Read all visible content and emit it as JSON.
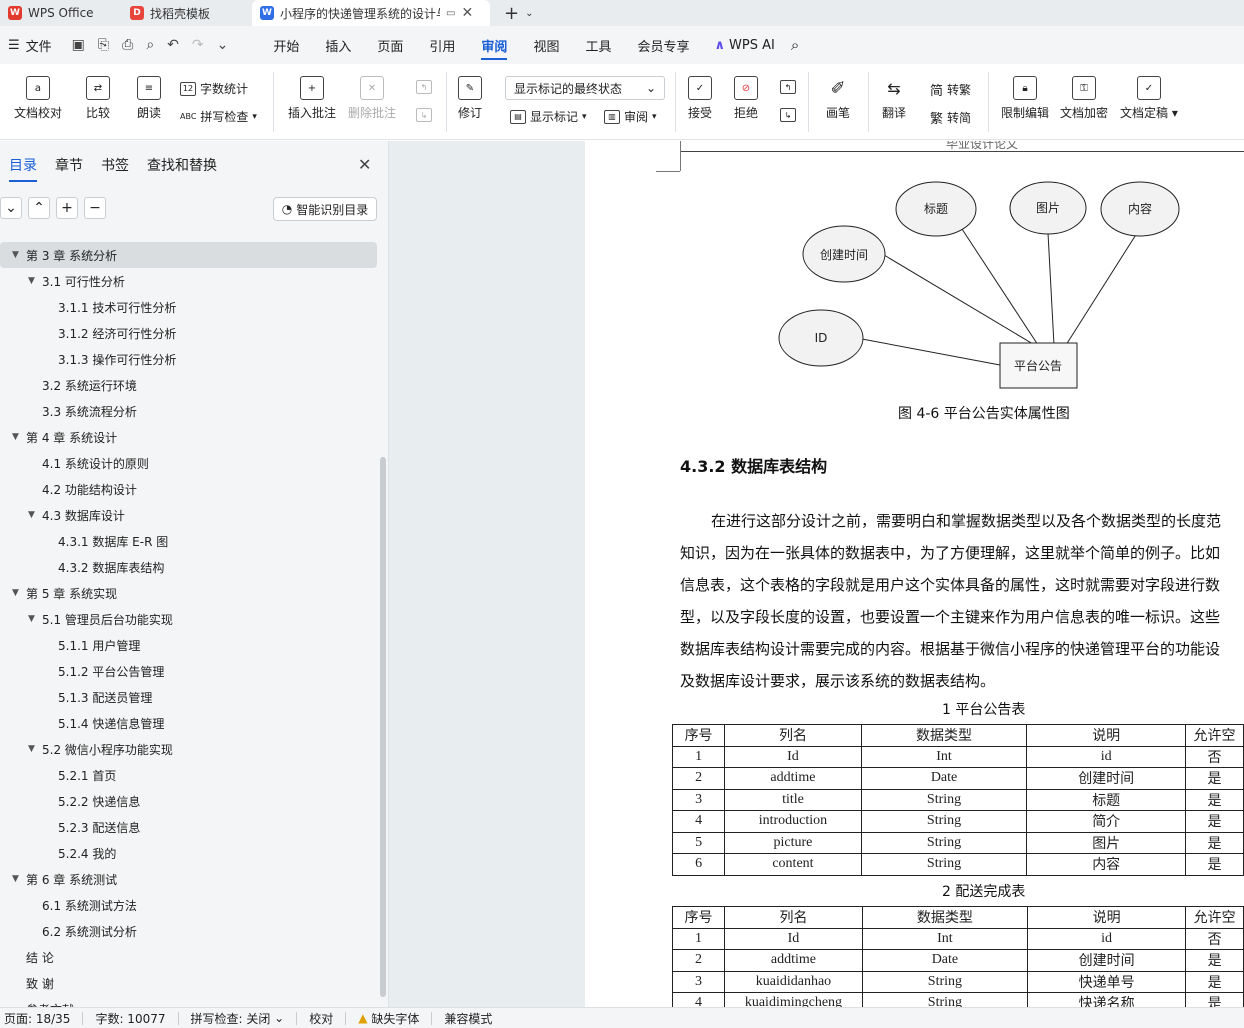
{
  "tabs": [
    {
      "label": "WPS Office"
    },
    {
      "label": "找稻壳模板"
    },
    {
      "label": "小程序的快递管理系统的设计与"
    }
  ],
  "menu": {
    "file": "文件",
    "items": [
      "开始",
      "插入",
      "页面",
      "引用",
      "审阅",
      "视图",
      "工具",
      "会员专享"
    ],
    "active": "审阅",
    "wps_ai": "WPS AI"
  },
  "ribbon": {
    "doc_check": "文档校对",
    "compare": "比较",
    "read_aloud": "朗读",
    "word_count": "字数统计",
    "spell_check": "拼写检查",
    "insert_comment": "插入批注",
    "delete_comment": "删除批注",
    "track": "修订",
    "markup_select": "显示标记的最终状态",
    "show_markup": "显示标记",
    "review": "审阅",
    "accept": "接受",
    "reject": "拒绝",
    "pen": "画笔",
    "translate": "翻译",
    "to_traditional": "转繁",
    "to_simplified": "转简",
    "restrict_edit": "限制编辑",
    "encrypt": "文档加密",
    "finalize": "文档定稿"
  },
  "nav": {
    "tabs": [
      "目录",
      "章节",
      "书签",
      "查找和替换"
    ],
    "smart_toc": "智能识别目录",
    "toc": [
      {
        "label": "第 3 章  系统分析",
        "level": 1,
        "expanded": true,
        "selected": true
      },
      {
        "label": "3.1 可行性分析",
        "level": 2,
        "expanded": true
      },
      {
        "label": "3.1.1 技术可行性分析",
        "level": 3
      },
      {
        "label": "3.1.2 经济可行性分析",
        "level": 3
      },
      {
        "label": "3.1.3 操作可行性分析",
        "level": 3
      },
      {
        "label": "3.2 系统运行环境",
        "level": 2
      },
      {
        "label": "3.3 系统流程分析",
        "level": 2
      },
      {
        "label": "第 4 章  系统设计",
        "level": 1,
        "expanded": true
      },
      {
        "label": "4.1  系统设计的原则",
        "level": 2
      },
      {
        "label": "4.2  功能结构设计",
        "level": 2
      },
      {
        "label": "4.3  数据库设计",
        "level": 2,
        "expanded": true
      },
      {
        "label": "4.3.1  数据库 E-R 图",
        "level": 3
      },
      {
        "label": "4.3.2  数据库表结构",
        "level": 3
      },
      {
        "label": "第 5 章  系统实现",
        "level": 1,
        "expanded": true
      },
      {
        "label": "5.1 管理员后台功能实现",
        "level": 2,
        "expanded": true
      },
      {
        "label": "5.1.1  用户管理",
        "level": 3
      },
      {
        "label": "5.1.2  平台公告管理",
        "level": 3
      },
      {
        "label": "5.1.3  配送员管理",
        "level": 3
      },
      {
        "label": "5.1.4  快递信息管理",
        "level": 3
      },
      {
        "label": "5.2  微信小程序功能实现",
        "level": 2,
        "expanded": true
      },
      {
        "label": "5.2.1  首页",
        "level": 3
      },
      {
        "label": "5.2.2  快递信息",
        "level": 3
      },
      {
        "label": "5.2.3  配送信息",
        "level": 3
      },
      {
        "label": "5.2.4  我的",
        "level": 3
      },
      {
        "label": "第 6 章  系统测试",
        "level": 1,
        "expanded": true
      },
      {
        "label": "6.1 系统测试方法",
        "level": 2
      },
      {
        "label": "6.2  系统测试分析",
        "level": 2
      },
      {
        "label": "结    论",
        "level": 1
      },
      {
        "label": "致    谢",
        "level": 1
      },
      {
        "label": "参考文献",
        "level": 1
      }
    ]
  },
  "doc": {
    "header_text": "毕业设计论文",
    "er": {
      "entity": "平台公告",
      "attributes": [
        "标题",
        "图片",
        "内容",
        "创建时间",
        "ID"
      ],
      "caption": "图 4-6  平台公告实体属性图"
    },
    "section_title": "4.3.2  数据库表结构",
    "paragraph_lines": [
      "在进行这部分设计之前，需要明白和掌握数据类型以及各个数据类型的长度范",
      "知识，因为在一张具体的数据表中，为了方便理解，这里就举个简单的例子。比如",
      "信息表，这个表格的字段就是用户这个实体具备的属性，这时就需要对字段进行数",
      "型，以及字段长度的设置，也要设置一个主键来作为用户信息表的唯一标识。这些",
      "数据库表结构设计需要完成的内容。根据基于微信小程序的快递管理平台的功能设",
      "及数据库设计要求，展示该系统的数据表结构。"
    ],
    "table1": {
      "caption": "1 平台公告表",
      "headers": [
        "序号",
        "列名",
        "数据类型",
        "说明",
        "允许空"
      ],
      "rows": [
        [
          "1",
          "Id",
          "Int",
          "id",
          "否"
        ],
        [
          "2",
          "addtime",
          "Date",
          "创建时间",
          "是"
        ],
        [
          "3",
          "title",
          "String",
          "标题",
          "是"
        ],
        [
          "4",
          "introduction",
          "String",
          "简介",
          "是"
        ],
        [
          "5",
          "picture",
          "String",
          "图片",
          "是"
        ],
        [
          "6",
          "content",
          "String",
          "内容",
          "是"
        ]
      ]
    },
    "table2": {
      "caption": "2 配送完成表",
      "headers": [
        "序号",
        "列名",
        "数据类型",
        "说明",
        "允许空"
      ],
      "rows": [
        [
          "1",
          "Id",
          "Int",
          "id",
          "否"
        ],
        [
          "2",
          "addtime",
          "Date",
          "创建时间",
          "是"
        ],
        [
          "3",
          "kuaididanhao",
          "String",
          "快递单号",
          "是"
        ],
        [
          "4",
          "kuaidimingcheng",
          "String",
          "快递名称",
          "是"
        ]
      ]
    }
  },
  "status": {
    "page": "页面: 18/35",
    "words": "字数: 10077",
    "spell": "拼写检查: 关闭",
    "proof": "校对",
    "missing_font": "缺失字体",
    "compat": "兼容模式"
  }
}
